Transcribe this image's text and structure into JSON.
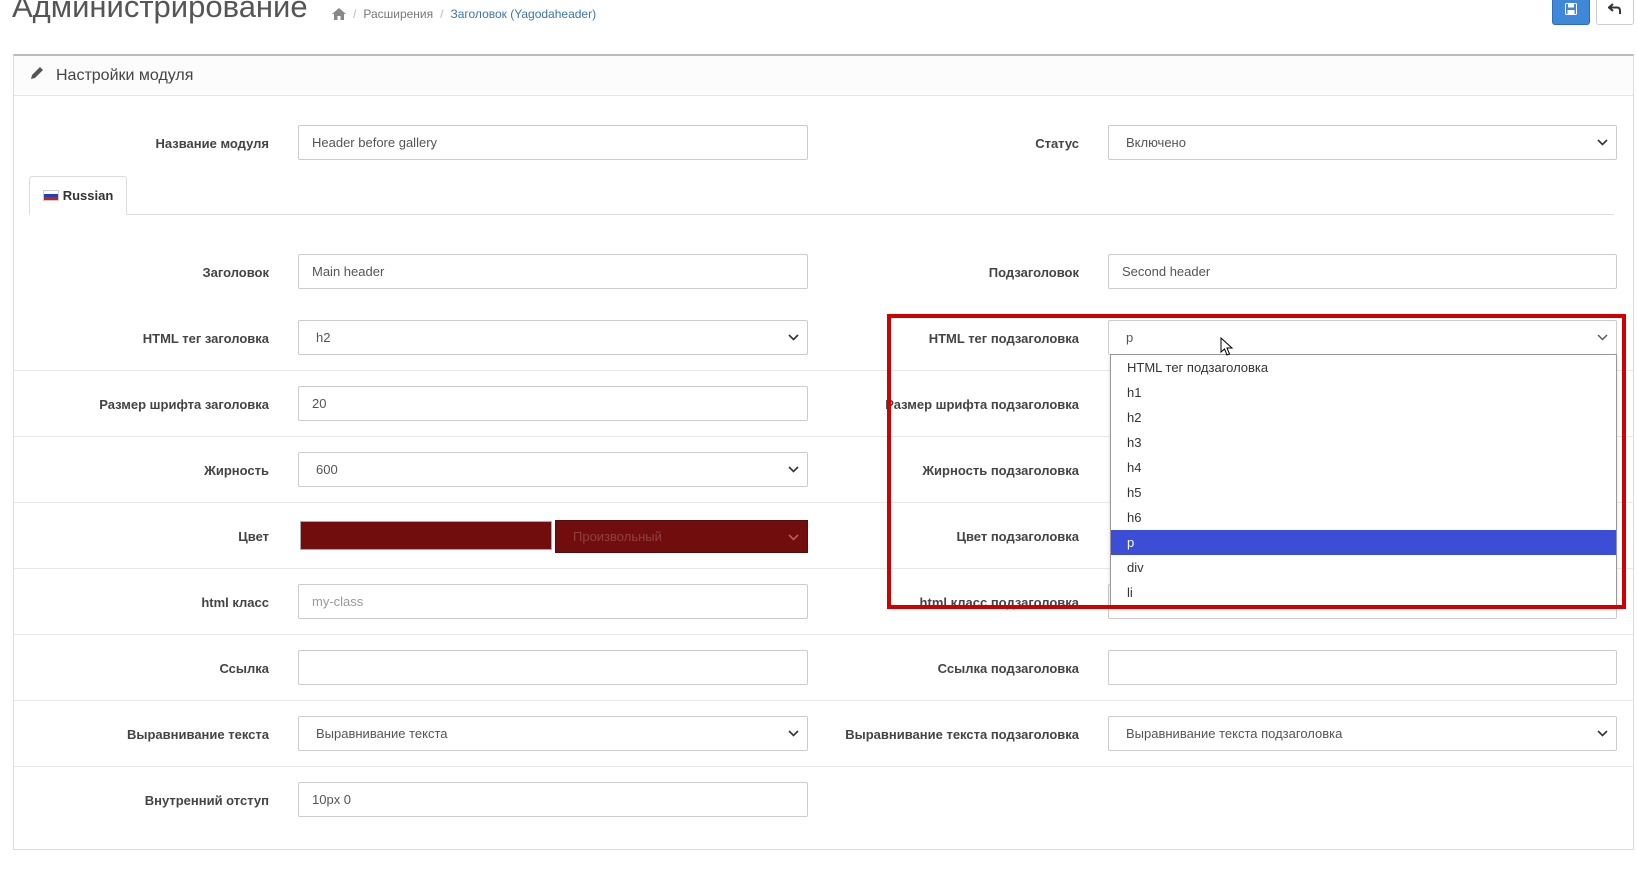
{
  "header": {
    "title": "Администрирование",
    "breadcrumb": [
      "Расширения",
      "Заголовок (Yagodaheader)"
    ]
  },
  "panel": {
    "title": "Настройки модуля"
  },
  "general": {
    "module_name_label": "Название модуля",
    "module_name_value": "Header before gallery",
    "status_label": "Статус",
    "status_value": "Включено"
  },
  "tab": {
    "language": "Russian"
  },
  "fields": {
    "heading_label": "Заголовок",
    "heading_value": "Main header",
    "subheading_label": "Подзаголовок",
    "subheading_value": "Second header",
    "heading_tag_label": "HTML тег заголовка",
    "heading_tag_value": "h2",
    "subheading_tag_label": "HTML тег подзаголовка",
    "subheading_tag_value": "p",
    "heading_font_size_label": "Размер шрифта заголовка",
    "heading_font_size_value": "20",
    "subheading_font_size_label": "Размер шрифта подзаголовка",
    "weight_label": "Жирность",
    "weight_value": "600",
    "subheading_weight_label": "Жирность подзаголовка",
    "color_label": "Цвет",
    "color_select_value": "Произвольный",
    "color_hex": "#720d0d",
    "subheading_color_label": "Цвет подзаголовка",
    "html_class_label": "html класс",
    "html_class_placeholder": "my-class",
    "subheading_html_class_label": "html класс подзаголовка",
    "link_label": "Ссылка",
    "subheading_link_label": "Ссылка подзаголовка",
    "align_label": "Выравнивание текста",
    "align_value": "Выравнивание текста",
    "subheading_align_label": "Выравнивание текста подзаголовка",
    "subheading_align_value": "Выравнивание текста подзаголовка",
    "padding_label": "Внутренний отступ",
    "padding_value": "10px 0"
  },
  "dropdown": {
    "options": [
      "HTML тег подзаголовка",
      "h1",
      "h2",
      "h3",
      "h4",
      "h5",
      "h6",
      "p",
      "div",
      "li"
    ],
    "selected": "p"
  },
  "colors": {
    "primary_button": "#3f87d8",
    "highlight": "#d00000",
    "selected_option": "#3c4ed5"
  }
}
